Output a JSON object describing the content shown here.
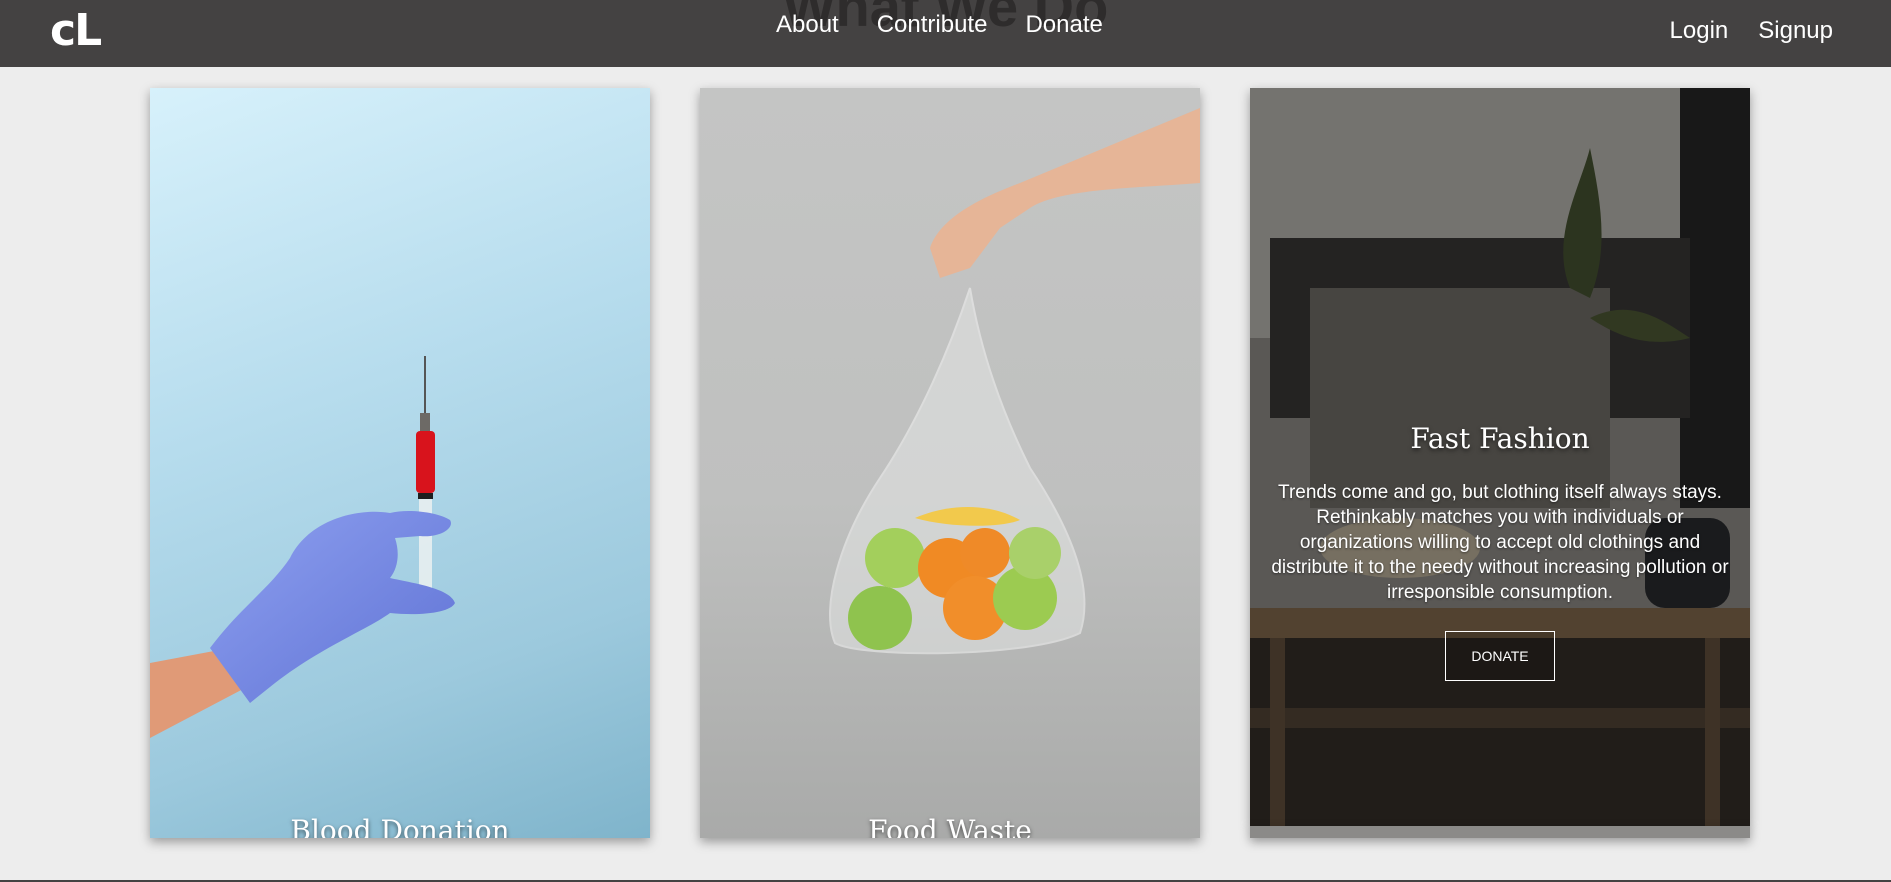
{
  "header": {
    "logo": "cL",
    "ghost_title": "What We Do",
    "nav_center": [
      "About",
      "Contribute",
      "Donate"
    ],
    "nav_right": [
      "Login",
      "Signup"
    ]
  },
  "cards": [
    {
      "title": "Blood Donation"
    },
    {
      "title": "Food Waste"
    },
    {
      "title": "Fast Fashion",
      "description": "Trends come and go, but clothing itself always stays. Rethinkably matches you with individuals or organizations willing to accept old clothings and distribute it to the needy without increasing pollution or irresponsible consumption.",
      "button_label": "DONATE"
    }
  ],
  "colors": {
    "navbar": "#444242",
    "page_background": "#ededed",
    "glove": "#7b8ee6",
    "blood": "#d8131c"
  }
}
